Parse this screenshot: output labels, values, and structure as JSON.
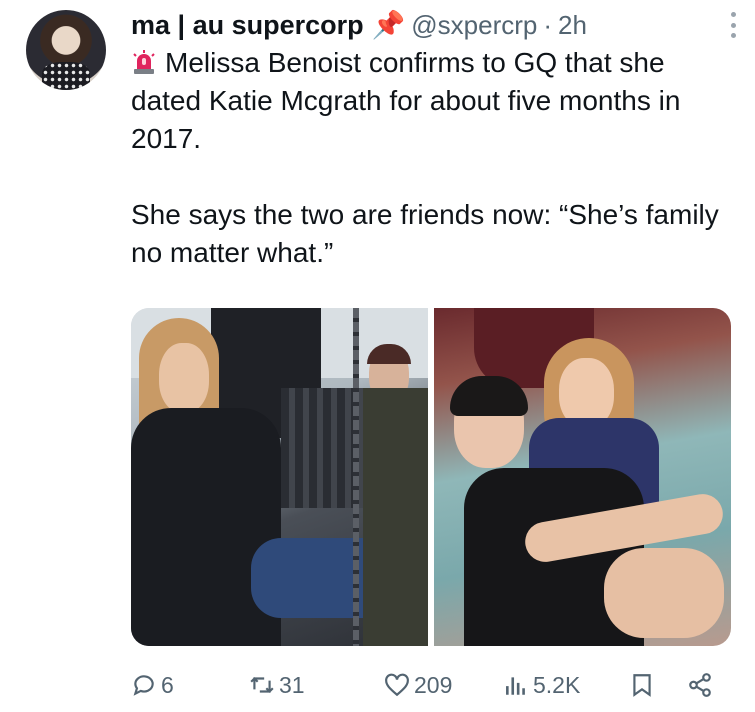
{
  "tweet": {
    "display_name": "ma | au supercorp",
    "pin_emoji": "📌",
    "handle": "@sxpercrp",
    "separator": "·",
    "time": "2h",
    "line1": "Melissa Benoist confirms to GQ that she dated Katie Mcgrath for about five months in 2017.",
    "line2": "She says the two are friends now: “She’s family no matter what.”"
  },
  "actions": {
    "replies": "6",
    "retweets": "31",
    "likes": "209",
    "views": "5.2K"
  },
  "icons": [
    "siren-icon",
    "more-icon",
    "reply-icon",
    "retweet-icon",
    "like-icon",
    "views-icon",
    "bookmark-icon",
    "share-icon"
  ],
  "colors": {
    "text": "#0f1419",
    "secondary": "#536471",
    "siren": "#e0245e"
  }
}
